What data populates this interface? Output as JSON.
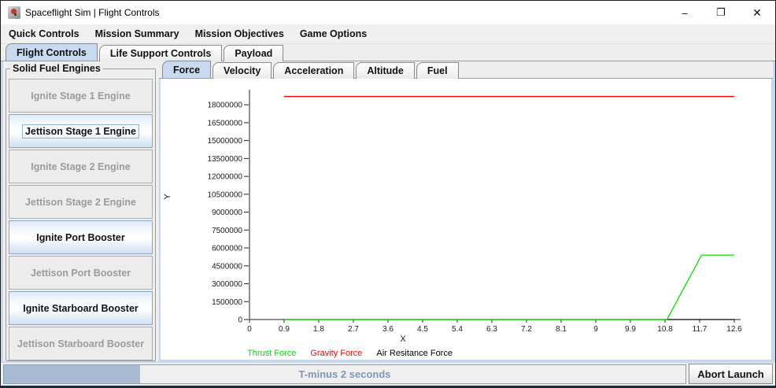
{
  "window": {
    "title": "Spaceflight Sim | Flight Controls",
    "controls": {
      "minimize": "–",
      "maximize": "❐",
      "close": "✕"
    }
  },
  "menubar": {
    "items": [
      {
        "label": "Quick Controls"
      },
      {
        "label": "Mission Summary"
      },
      {
        "label": "Mission Objectives"
      },
      {
        "label": "Game Options"
      }
    ]
  },
  "main_tabs": [
    {
      "label": "Flight Controls",
      "selected": true
    },
    {
      "label": "Life Support Controls",
      "selected": false
    },
    {
      "label": "Payload",
      "selected": false
    }
  ],
  "left_panel": {
    "group_title": "Solid Fuel Engines",
    "buttons": [
      {
        "label": "Ignite Stage 1 Engine",
        "enabled": false
      },
      {
        "label": "Jettison Stage 1 Engine",
        "enabled": true,
        "focused": true
      },
      {
        "label": "Ignite Stage 2 Engine",
        "enabled": false
      },
      {
        "label": "Jettison Stage 2 Engine",
        "enabled": false
      },
      {
        "label": "Ignite Port Booster",
        "enabled": true
      },
      {
        "label": "Jettison Port Booster",
        "enabled": false
      },
      {
        "label": "Ignite Starboard Booster",
        "enabled": true
      },
      {
        "label": "Jettison Starboard Booster",
        "enabled": false
      }
    ]
  },
  "chart_tabs": [
    {
      "label": "Force",
      "selected": true
    },
    {
      "label": "Velocity",
      "selected": false
    },
    {
      "label": "Acceleration",
      "selected": false
    },
    {
      "label": "Altitude",
      "selected": false
    },
    {
      "label": "Fuel",
      "selected": false
    }
  ],
  "chart_data": {
    "type": "line",
    "title": "",
    "xlabel": "X",
    "ylabel": "Y",
    "xlim": [
      0,
      12.6
    ],
    "ylim": [
      0,
      19000000
    ],
    "grid": false,
    "x_ticks": [
      0,
      0.9,
      1.8,
      2.7,
      3.6,
      4.5,
      5.4,
      6.3,
      7.2,
      8.1,
      9,
      9.9,
      10.8,
      11.7,
      12.6
    ],
    "y_ticks": [
      0,
      1500000,
      3000000,
      4500000,
      6000000,
      7500000,
      9000000,
      10500000,
      12000000,
      13500000,
      15000000,
      16500000,
      18000000
    ],
    "legend_position": "bottom",
    "series": [
      {
        "name": "Thrust Force",
        "color": "#00e000",
        "points": [
          [
            0.9,
            0
          ],
          [
            10.85,
            0
          ],
          [
            11.75,
            5400000
          ],
          [
            12.6,
            5400000
          ]
        ]
      },
      {
        "name": "Gravity Force",
        "color": "#ff0000",
        "points": [
          [
            0.9,
            18700000
          ],
          [
            12.6,
            18700000
          ]
        ]
      },
      {
        "name": "Air Resitance Force",
        "color": "#000000",
        "points": [
          [
            0.9,
            0
          ],
          [
            12.6,
            0
          ]
        ]
      }
    ]
  },
  "legend": [
    {
      "label": "Thrust Force",
      "color": "#00dd00"
    },
    {
      "label": "Gravity Force",
      "color": "#ff0000"
    },
    {
      "label": "Air Resitance Force",
      "color": "#000000"
    }
  ],
  "bottom": {
    "progress_text": "T-minus 2 seconds",
    "progress_percent": 20,
    "progress_text_color": "#7d97bb",
    "abort_label": "Abort Launch"
  }
}
